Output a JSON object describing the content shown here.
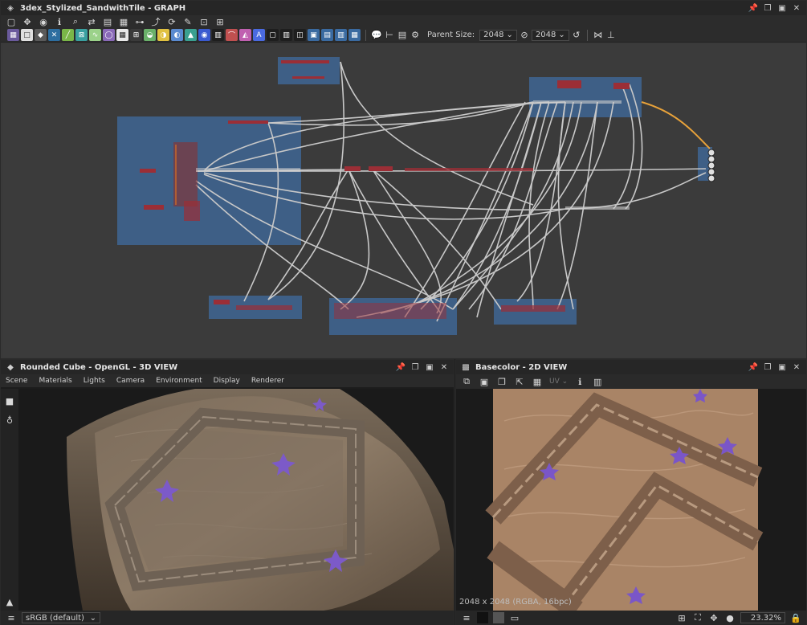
{
  "graph": {
    "title": "3dex_Stylized_SandwithTile - GRAPH",
    "parent_size_label": "Parent Size:",
    "parent_size_value": "2048",
    "size_value": "2048",
    "toolbar_colors": [
      "#6a5a9c",
      "#e0e0e0",
      "#5a5a5a",
      "#2d6ea0",
      "#7ab648",
      "#3aa0a0",
      "#9bd28a",
      "#8a6ab8",
      "#e8e8e8",
      "#3a3a3a",
      "#6ab06a",
      "#e0c040",
      "#5a8ad0",
      "#3aa090",
      "#3a5ad0",
      "#1e1e1e",
      "#c05050",
      "#c060b0",
      "#4a6ae0",
      "#1e1e1e",
      "#3a6aa0",
      "#3a6aa0",
      "#3a6aa0",
      "#3a6aa0"
    ]
  },
  "view3d": {
    "title": "Rounded Cube - OpenGL - 3D VIEW",
    "menu": [
      "Scene",
      "Materials",
      "Lights",
      "Camera",
      "Environment",
      "Display",
      "Renderer"
    ],
    "colorspace": "sRGB (default)"
  },
  "view2d": {
    "title": "Basecolor - 2D VIEW",
    "uv_label": "UV",
    "info": "2048 x 2048 (RGBA, 16bpc)",
    "zoom": "23.32%"
  }
}
